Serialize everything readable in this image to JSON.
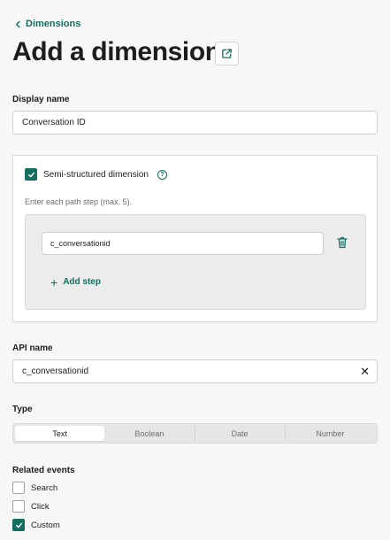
{
  "breadcrumb": {
    "label": "Dimensions"
  },
  "header": {
    "title": "Add a dimension"
  },
  "display_name": {
    "label": "Display name",
    "value": "Conversation ID"
  },
  "semi_structured": {
    "label": "Semi-structured dimension",
    "checked": true,
    "hint": "Enter each path step (max. 5).",
    "steps": [
      {
        "value": "c_conversationid"
      }
    ],
    "add_step_label": "Add step"
  },
  "api_name": {
    "label": "API name",
    "value": "c_conversationid"
  },
  "type": {
    "label": "Type",
    "options": [
      "Text",
      "Boolean",
      "Date",
      "Number"
    ],
    "selected": "Text"
  },
  "related_events": {
    "label": "Related events",
    "items": [
      {
        "label": "Search",
        "checked": false
      },
      {
        "label": "Click",
        "checked": false
      },
      {
        "label": "Custom",
        "checked": true
      }
    ]
  },
  "colors": {
    "accent": "#146d5e",
    "background": "#f7f7f7",
    "text": "#1c1d1f",
    "muted": "#6b6e72"
  },
  "icons": {
    "back": "chevron-left-icon",
    "external": "external-link-icon",
    "help": "help-circle-icon",
    "delete": "trash-icon",
    "add": "plus-icon",
    "clear": "close-icon",
    "check": "checkmark-icon"
  }
}
